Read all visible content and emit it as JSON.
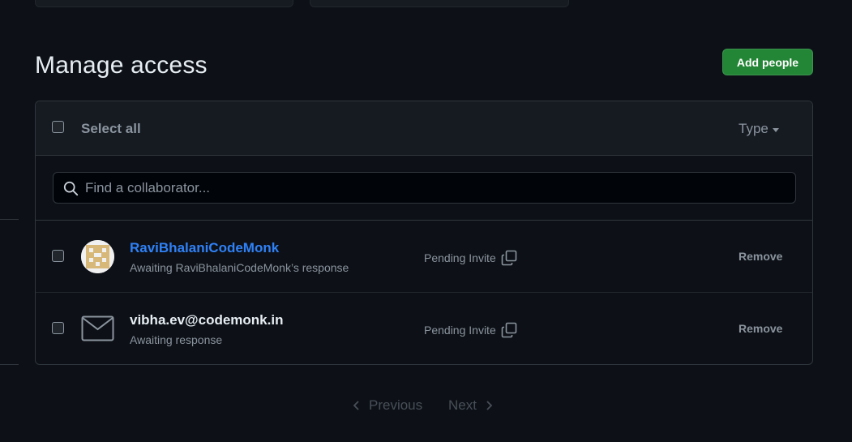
{
  "header": {
    "title": "Manage access",
    "add_button_label": "Add people"
  },
  "toolbar": {
    "select_all_label": "Select all",
    "type_filter_label": "Type"
  },
  "search": {
    "placeholder": "Find a collaborator...",
    "value": ""
  },
  "collaborators": [
    {
      "name": "RaviBhalaniCodeMonk",
      "subtitle": "Awaiting RaviBhalaniCodeMonk’s response",
      "status": "Pending Invite",
      "remove_label": "Remove",
      "avatar": "identicon-avatar"
    },
    {
      "name": "vibha.ev@codemonk.in",
      "subtitle": "Awaiting response",
      "status": "Pending Invite",
      "remove_label": "Remove",
      "avatar": "mail-icon"
    }
  ],
  "pagination": {
    "previous_label": "Previous",
    "next_label": "Next"
  },
  "colors": {
    "background": "#0d1117",
    "accent_button": "#238636",
    "link": "#2f81f7",
    "muted_text": "#8b949e"
  }
}
